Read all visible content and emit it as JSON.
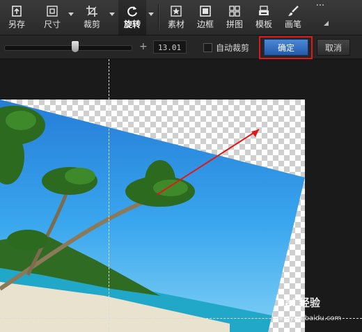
{
  "toolbar": {
    "save_as": "另存",
    "size": "尺寸",
    "crop": "裁剪",
    "rotate": "旋转",
    "material": "素材",
    "border": "边框",
    "collage": "拼图",
    "template": "模板",
    "brush": "画笔",
    "more": "···"
  },
  "control_bar": {
    "rotation_value": "13.01",
    "rotation_level_degrees": 13.01,
    "plus": "+",
    "auto_crop_label": "自动裁剪",
    "ok_label": "确定",
    "cancel_label": "取消"
  },
  "watermark": {
    "text": "Bai 经验",
    "url": "jingyan.baidu.com"
  },
  "colors": {
    "accent_button": "#2f6fc4",
    "highlight_box": "#e01818",
    "arrow": "#e01818"
  }
}
